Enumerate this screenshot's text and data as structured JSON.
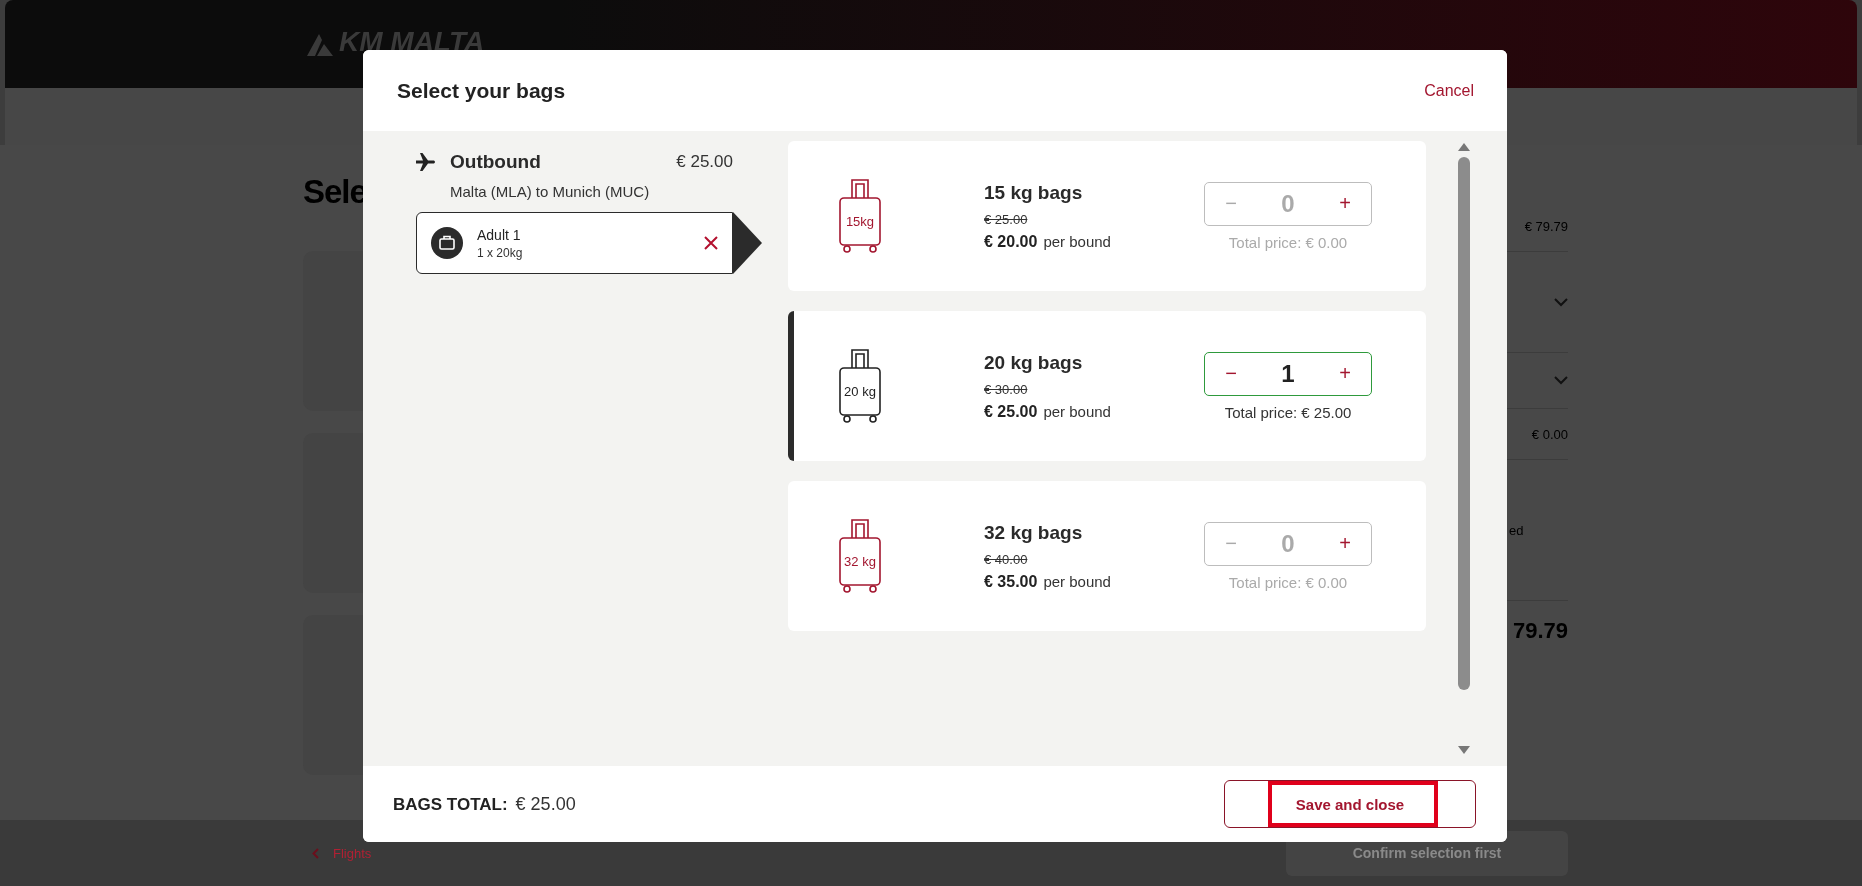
{
  "page": {
    "logo": "KM MALTA",
    "heading": "Sele",
    "summary": [
      {
        "kind": "price",
        "value": "€ 79.79"
      },
      {
        "kind": "expander"
      },
      {
        "kind": "expander"
      },
      {
        "kind": "price",
        "value": "€ 0.00"
      },
      {
        "kind": "note",
        "value": "ed"
      },
      {
        "kind": "total",
        "value": "79.79"
      }
    ],
    "back_link": "Flights",
    "confirm_button": {
      "label": "Confirm selection first",
      "disabled": true
    }
  },
  "modal": {
    "title": "Select your bags",
    "cancel": "Cancel",
    "flight": {
      "label": "Outbound",
      "price": "€ 25.00",
      "route": "Malta (MLA) to Munich (MUC)"
    },
    "passengers": [
      {
        "name": "Adult 1",
        "bags": "1 x 20kg",
        "selected": true
      }
    ],
    "options": [
      {
        "title": "15 kg bags",
        "icon_label": "15kg",
        "old_price": "€ 25.00",
        "price": "€ 20.00",
        "unit": "per bound",
        "minus": "−",
        "count": "0",
        "plus": "+",
        "total": "Total price: € 0.00",
        "selected": false
      },
      {
        "title": "20 kg bags",
        "icon_label": "20 kg",
        "old_price": "€ 30.00",
        "price": "€ 25.00",
        "unit": "per bound",
        "minus": "−",
        "count": "1",
        "plus": "+",
        "total": "Total price: € 25.00",
        "selected": true
      },
      {
        "title": "32 kg bags",
        "icon_label": "32 kg",
        "old_price": "€ 40.00",
        "price": "€ 35.00",
        "unit": "per bound",
        "minus": "−",
        "count": "0",
        "plus": "+",
        "total": "Total price: € 0.00",
        "selected": false
      }
    ],
    "total_label": "BAGS TOTAL:",
    "total": "€ 25.00",
    "save": "Save and close"
  }
}
